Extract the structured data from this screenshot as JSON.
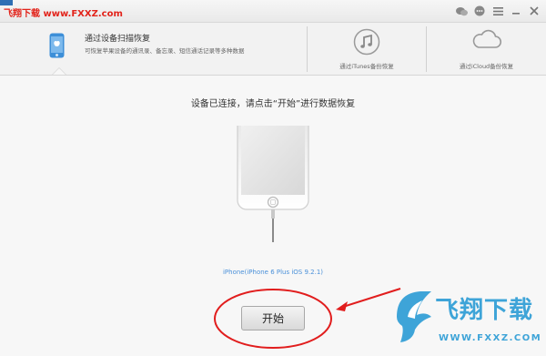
{
  "window": {
    "watermark": "飞翔下载 www.FXXZ.com"
  },
  "modes": {
    "active": {
      "title": "通过设备扫描恢复",
      "subtitle": "可恢复苹果设备的通讯录、备忘录、短信通话记录等多种数据"
    },
    "itunes": {
      "label": "通过iTunes备份恢复"
    },
    "icloud": {
      "label": "通过iCloud备份恢复"
    }
  },
  "main": {
    "status_text": "设备已连接，请点击“开始”进行数据恢复",
    "device_name": "iPhone(iPhone 6 Plus iOS 9.2.1)",
    "start_label": "开始"
  },
  "brand": {
    "name": "飞翔下载",
    "url": "WWW.FXXZ.COM"
  },
  "colors": {
    "accent_blue": "#4a90d9",
    "annotation_red": "#e11d1d",
    "brand_blue": "#3ea4d8"
  }
}
